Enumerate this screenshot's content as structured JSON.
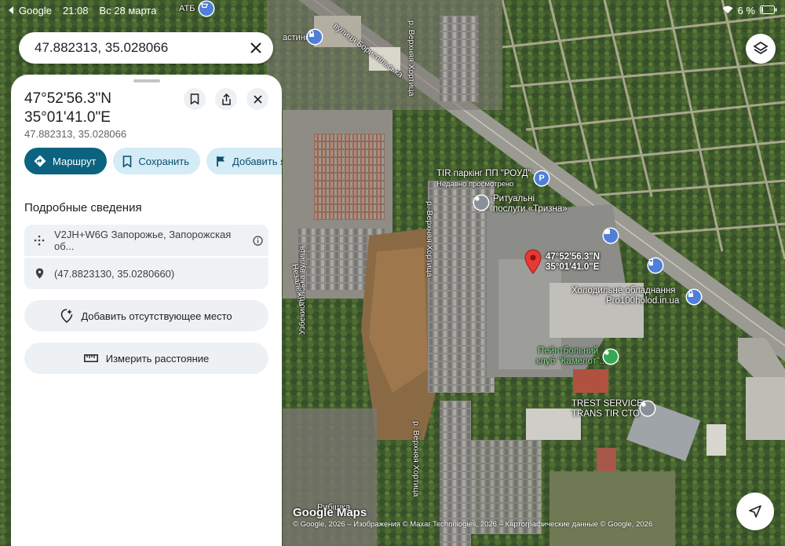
{
  "status_bar": {
    "app": "Google",
    "time": "21:08",
    "date": "Вс 28 марта",
    "battery": "6 %",
    "icons": [
      "back-arrow-icon",
      "wifi-icon",
      "battery-icon"
    ]
  },
  "search": {
    "query": "47.882313, 35.028066"
  },
  "panel": {
    "title_line1": "47°52'56.3\"N",
    "title_line2": "35°01'41.0\"E",
    "decimal_coords": "47.882313, 35.028066",
    "actions": {
      "route": "Маршрут",
      "save": "Сохранить",
      "add_label": "Добавить я"
    },
    "details_heading": "Подробные сведения",
    "plus_code": "V2JH+W6G Запорожье, Запорожская об...",
    "coords_row": "(47.8823130, 35.0280660)",
    "add_place": "Добавить отсутствующее место",
    "measure": "Измерить расстояние"
  },
  "map": {
    "pin_label_line1": "47°52'56.3\"N",
    "pin_label_line2": "35°01'41.0\"E",
    "poi_tir_line1": "TIR паркінг ПП \"РОУД\"",
    "poi_tir_line2": "Недавно просмотрено",
    "poi_ritual_line1": "Ритуальні",
    "poi_ritual_line2": "послуги «Тризна»",
    "poi_cold_line1": "Холодильне обладнання",
    "poi_cold_line2": "Pro100holod.in.ua",
    "poi_paintball_line1": "Пейнтбольний",
    "poi_paintball_line2": "клуб \"Камелот\"...",
    "poi_trest_line1": "TREST SERVICE",
    "poi_trest_line2": "TRANS TIR СТО",
    "shop_atb": "АТБ",
    "label_vastini": "астині",
    "label_ryshka": "Рибішка",
    "road_borysp": "вулиця Бориспільська",
    "road_khortytsia": "р. Верхняя Хортица",
    "road_khortytsia2": "р. Верхняя Хортица",
    "road_khortytsia3": "р. Верхняя Хортица",
    "road_uzbek": "Узбекистанська вулиця",
    "road_nezalezhna": "Незалежна",
    "logo": "Google Maps",
    "attribution": "© Google, 2026 – Изображения © Maxar Technologies, 2026 – Картографические данные © Google, 2026"
  },
  "colors": {
    "primary_chip": "#0b6380",
    "secondary_chip": "#d4ecf6",
    "pin": "#e53935",
    "poi_green": "#34a853",
    "poi_blue": "#4f7fd9",
    "poi_grey": "#8a9099"
  }
}
